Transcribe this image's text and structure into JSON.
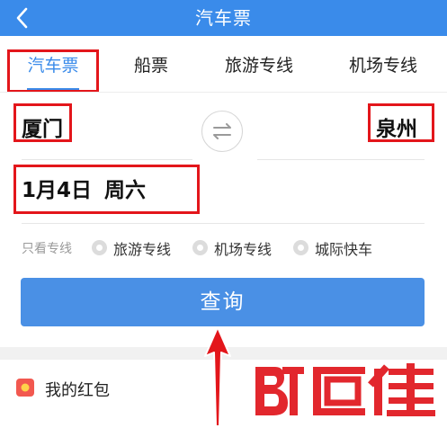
{
  "header": {
    "title": "汽车票",
    "back_icon": "chevron-left-icon"
  },
  "tabs": [
    {
      "label": "汽车票",
      "active": true
    },
    {
      "label": "船票",
      "active": false
    },
    {
      "label": "旅游专线",
      "active": false
    },
    {
      "label": "机场专线",
      "active": false
    }
  ],
  "route": {
    "from": "厦门",
    "to": "泉州",
    "swap_icon": "swap-arrows-icon"
  },
  "date": {
    "value": "1月4日",
    "weekday": "周六"
  },
  "filter": {
    "label": "只看专线",
    "options": [
      "旅游专线",
      "机场专线",
      "城际快车"
    ]
  },
  "search": {
    "label": "查询"
  },
  "wallet": {
    "label": "我的红包",
    "icon": "red-packet-icon"
  },
  "watermark": {
    "text": "百佳"
  },
  "colors": {
    "brand_blue": "#3a8bea",
    "button_blue": "#4a90e5",
    "highlight_red": "#e3161b"
  }
}
